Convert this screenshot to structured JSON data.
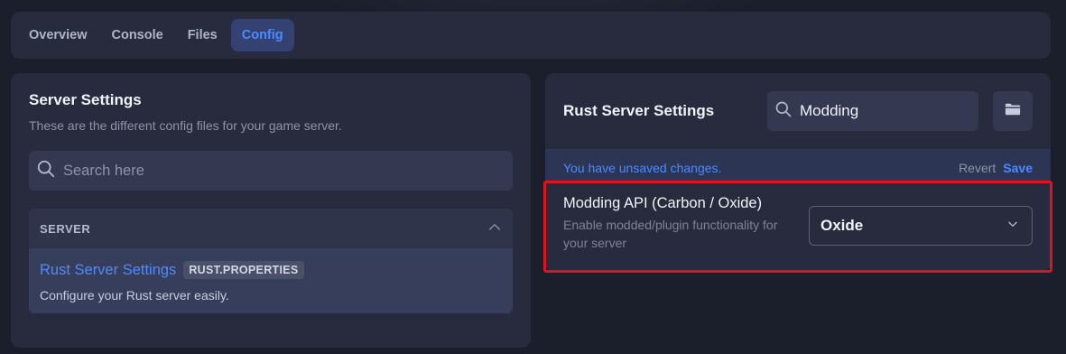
{
  "tabs": [
    {
      "label": "Overview",
      "active": false
    },
    {
      "label": "Console",
      "active": false
    },
    {
      "label": "Files",
      "active": false
    },
    {
      "label": "Config",
      "active": true
    }
  ],
  "left_panel": {
    "title": "Server Settings",
    "subtitle": "These are the different config files for your game server.",
    "search_placeholder": "Search here",
    "section": {
      "header": "SERVER",
      "item": {
        "title": "Rust Server Settings",
        "badge": "RUST.PROPERTIES",
        "description": "Configure your Rust server easily."
      }
    }
  },
  "right_panel": {
    "title": "Rust Server Settings",
    "search_value": "Modding",
    "unsaved": {
      "message": "You have unsaved changes.",
      "revert_label": "Revert",
      "save_label": "Save"
    },
    "setting": {
      "label": "Modding API (Carbon / Oxide)",
      "description": "Enable modded/plugin functionality for your server",
      "selected_value": "Oxide"
    }
  },
  "colors": {
    "accent": "#4b8bff",
    "highlight": "#e0121b",
    "panel": "#272b3d"
  },
  "icons": {
    "search": "search-icon",
    "folder": "folder-icon",
    "chevron_up": "chevron-up-icon",
    "chevron_down": "chevron-down-icon"
  }
}
